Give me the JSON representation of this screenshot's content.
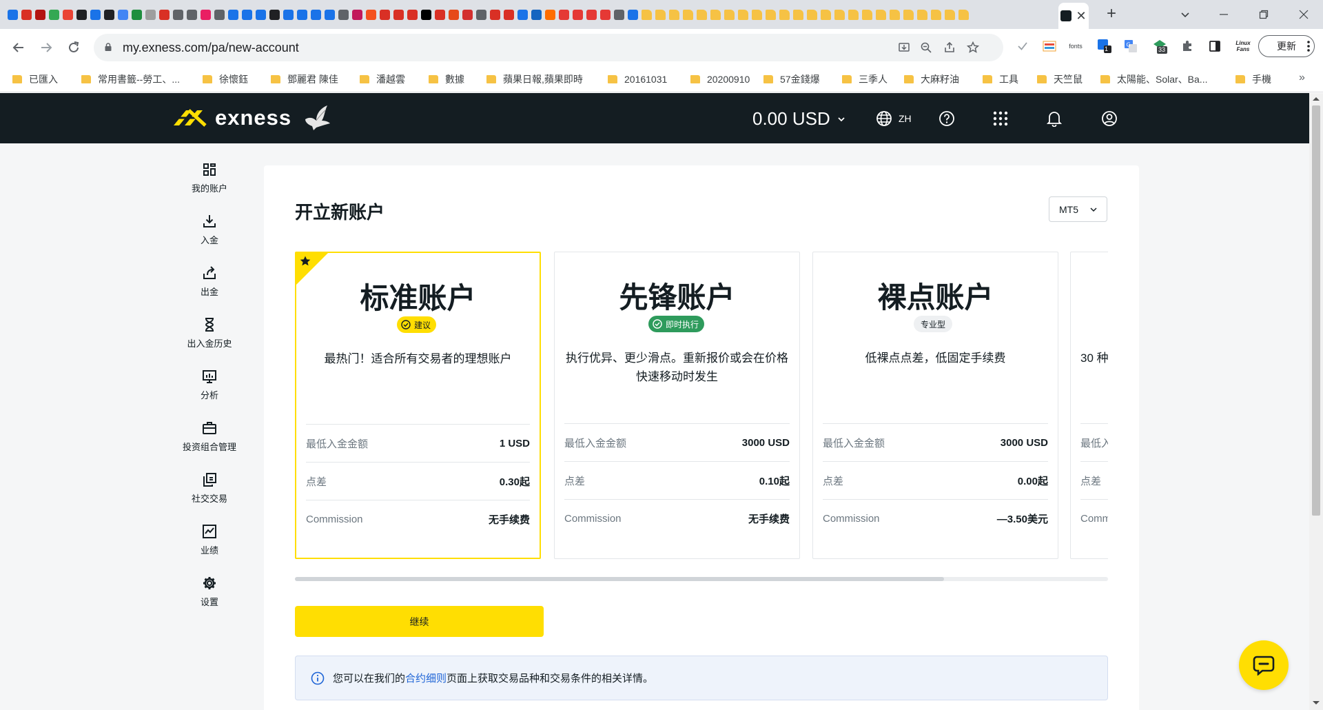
{
  "browser": {
    "url": "my.exness.com/pa/new-account",
    "update_label": "更新",
    "extension_badge_1": "1",
    "extension_badge_2": "33",
    "fonts_label": "fonts",
    "linuxfans_label": "Linux Fans",
    "bookmarks": [
      "已匯入",
      "常用書籤--勞工、...",
      "徐懷鈺",
      "鄧麗君 陳佳",
      "潘越雲",
      "數據",
      "蘋果日報,蘋果即時",
      "20161031",
      "20200910",
      "57金錢爆",
      "三季人",
      "大麻籽油",
      "工具",
      "天竺鼠",
      "太陽能、Solar、Ba...",
      "手機"
    ]
  },
  "header": {
    "brand": "exness",
    "balance": "0.00 USD",
    "lang": "ZH"
  },
  "sidebar": {
    "items": [
      {
        "label": "我的账户",
        "icon": "grid-icon"
      },
      {
        "label": "入金",
        "icon": "deposit-icon"
      },
      {
        "label": "出金",
        "icon": "withdraw-icon"
      },
      {
        "label": "出入金历史",
        "icon": "hourglass-icon"
      },
      {
        "label": "分析",
        "icon": "analytics-icon"
      },
      {
        "label": "投资组合管理",
        "icon": "briefcase-icon"
      },
      {
        "label": "社交交易",
        "icon": "copy-icon"
      },
      {
        "label": "业绩",
        "icon": "performance-icon"
      },
      {
        "label": "设置",
        "icon": "gear-icon"
      }
    ]
  },
  "main": {
    "title": "开立新账户",
    "platform": "MT5",
    "accounts": [
      {
        "name": "标准账户",
        "badge": "建议",
        "desc": "最热门！适合所有交易者的理想账户",
        "rows": [
          {
            "k": "最低入金金额",
            "v": "1 USD"
          },
          {
            "k": "点差",
            "v": "0.30起"
          },
          {
            "k": "Commission",
            "v": "无手续费"
          }
        ]
      },
      {
        "name": "先锋账户",
        "badge": "即时执行",
        "desc": "执行优异、更少滑点。重新报价或会在价格快速移动时发生",
        "rows": [
          {
            "k": "最低入金金额",
            "v": "3000 USD"
          },
          {
            "k": "点差",
            "v": "0.10起"
          },
          {
            "k": "Commission",
            "v": "无手续费"
          }
        ]
      },
      {
        "name": "裸点账户",
        "badge": "专业型",
        "desc": "低裸点点差，低固定手续费",
        "rows": [
          {
            "k": "最低入金金额",
            "v": "3000 USD"
          },
          {
            "k": "点差",
            "v": "0.00起"
          },
          {
            "k": "Commission",
            "v": "—3.50美元"
          }
        ]
      },
      {
        "name": "",
        "badge": "",
        "desc": "30 种",
        "rows": [
          {
            "k": "最低入",
            "v": ""
          },
          {
            "k": "点差",
            "v": ""
          },
          {
            "k": "Comm",
            "v": ""
          }
        ]
      }
    ],
    "continue_label": "继续",
    "info_prefix": "您可以在我们的",
    "info_link": "合约细则",
    "info_suffix": "页面上获取交易品种和交易条件的相关详情。"
  },
  "colors": {
    "brand_yellow": "#ffde02",
    "header_dark": "#141d22",
    "instant_green": "#2e9b5c",
    "link_blue": "#1e64d6"
  }
}
